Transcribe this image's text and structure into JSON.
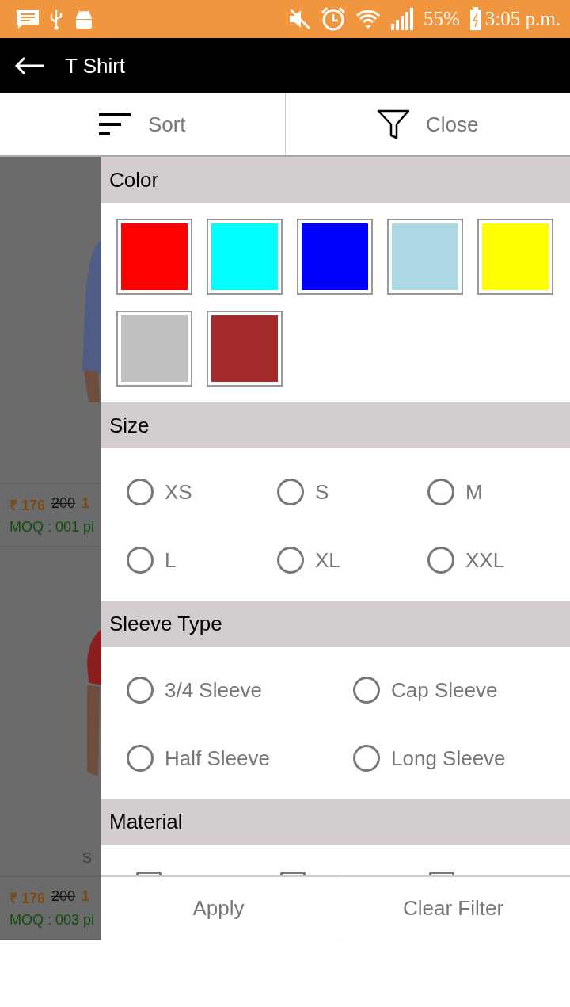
{
  "status_bar": {
    "battery": "55%",
    "time": "3:05 p.m."
  },
  "app_bar": {
    "title": "T Shirt"
  },
  "toolbar": {
    "sort": "Sort",
    "filter": "Close"
  },
  "products": [
    {
      "kind": "picture",
      "price": "₹ 176",
      "old_price": "200",
      "extra": "1",
      "moq": "MOQ : 001 pi"
    },
    {
      "kind": "picture",
      "caption": "S",
      "price": "₹ 176",
      "old_price": "200",
      "extra": "1",
      "moq": "MOQ : 003 pi"
    }
  ],
  "filters": [
    {
      "kind": "swatches",
      "title": "Color",
      "options": [
        {
          "color": "#ff0000"
        },
        {
          "color": "#00ffff"
        },
        {
          "color": "#0000ff"
        },
        {
          "color": "#add8e6"
        },
        {
          "color": "#ffff00"
        },
        {
          "color": "#c0c0c0"
        },
        {
          "color": "#a52a2a"
        }
      ]
    },
    {
      "kind": "radios",
      "title": "Size",
      "options": [
        {
          "label": "XS",
          "selected": false
        },
        {
          "label": "S",
          "selected": false
        },
        {
          "label": "M",
          "selected": false
        },
        {
          "label": "L",
          "selected": false
        },
        {
          "label": "XL",
          "selected": false
        },
        {
          "label": "XXL",
          "selected": false
        }
      ]
    },
    {
      "kind": "radios",
      "title": "Sleeve Type",
      "options": [
        {
          "label": "3/4 Sleeve",
          "selected": false
        },
        {
          "label": "Cap Sleeve",
          "selected": false
        },
        {
          "label": "Half Sleeve",
          "selected": false
        },
        {
          "label": "Long Sleeve",
          "selected": false
        }
      ]
    },
    {
      "kind": "checks",
      "title": "Material",
      "options": [
        {
          "checked": false
        },
        {
          "checked": false
        },
        {
          "checked": false
        }
      ]
    }
  ],
  "actions": {
    "apply": "Apply",
    "clear": "Clear Filter"
  }
}
